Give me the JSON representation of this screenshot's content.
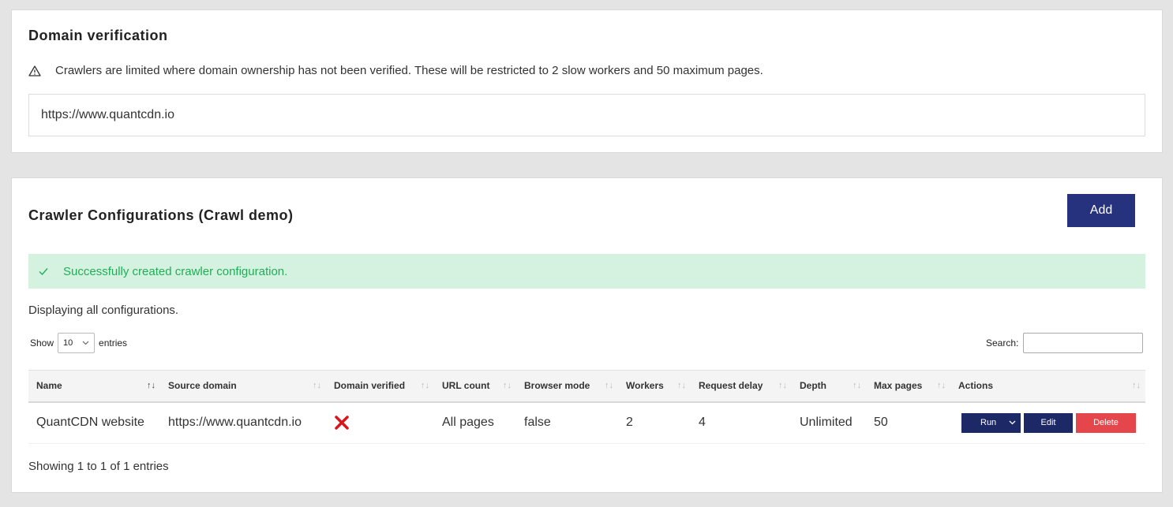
{
  "domain_card": {
    "title": "Domain verification",
    "warning_icon": "warning-triangle-icon",
    "warning_text": "Crawlers are limited where domain ownership has not been verified. These will be restricted to 2 slow workers and 50 maximum pages.",
    "domain_value": "https://www.quantcdn.io"
  },
  "config_card": {
    "title": "Crawler Configurations (Crawl demo)",
    "add_label": "Add",
    "alert_text": "Successfully created crawler configuration.",
    "display_text": "Displaying all configurations.",
    "show_label": "Show",
    "page_size": "10",
    "entries_label": "entries",
    "search_label": "Search:",
    "search_value": "",
    "footer_text": "Showing 1 to 1 of 1 entries"
  },
  "table": {
    "columns": [
      "Name",
      "Source domain",
      "Domain verified",
      "URL count",
      "Browser mode",
      "Workers",
      "Request delay",
      "Depth",
      "Max pages",
      "Actions"
    ],
    "rows": [
      {
        "name": "QuantCDN website",
        "source_domain": "https://www.quantcdn.io",
        "domain_verified": "cross-icon",
        "url_count": "All pages",
        "browser_mode": "false",
        "workers": "2",
        "request_delay": "4",
        "depth": "Unlimited",
        "max_pages": "50",
        "run_label": "Run",
        "edit_label": "Edit",
        "delete_label": "Delete"
      }
    ]
  },
  "colors": {
    "primary": "#26327e",
    "success_bg": "#d5f2e0",
    "success_text": "#1fae57",
    "danger": "#e5464b",
    "cross": "#d9141a"
  }
}
